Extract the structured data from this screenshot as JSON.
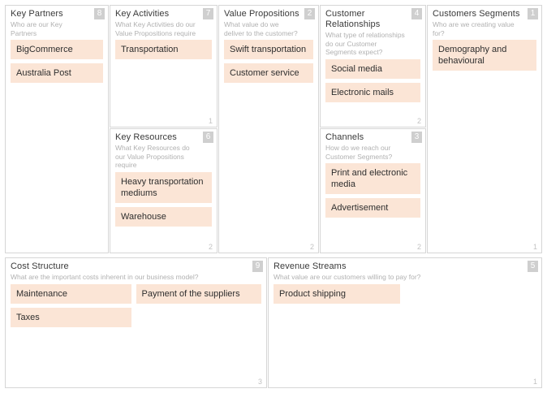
{
  "canvas": {
    "name": "Business Model Canvas",
    "note_color": "#fbe5d6",
    "badge_color": "#cfcfcf",
    "border_color": "#d6d6d6"
  },
  "blocks": {
    "key_partners": {
      "title": "Key Partners",
      "subtitle": "Who are our Key Partners",
      "badge": "8",
      "count": "",
      "notes": [
        "BigCommerce",
        "Australia Post"
      ]
    },
    "key_activities": {
      "title": "Key Activities",
      "subtitle": "What Key Activities do our Value Propositions require",
      "badge": "7",
      "count": "1",
      "notes": [
        "Transportation"
      ]
    },
    "key_resources": {
      "title": "Key Resources",
      "subtitle": "What Key Resources do our Value Propositions require",
      "badge": "6",
      "count": "2",
      "notes": [
        "Heavy transportation mediums",
        "Warehouse"
      ]
    },
    "value_propositions": {
      "title": "Value Propositions",
      "subtitle": "What value do we deliver to the customer?",
      "badge": "2",
      "count": "2",
      "notes": [
        "Swift transportation",
        "Customer service"
      ]
    },
    "customer_relationships": {
      "title": "Customer Relationships",
      "subtitle": "What type of relationships do our Customer Segments expect?",
      "badge": "4",
      "count": "2",
      "notes": [
        "Social media",
        "Electronic mails"
      ]
    },
    "channels": {
      "title": "Channels",
      "subtitle": "How do we reach our Customer Segments?",
      "badge": "3",
      "count": "2",
      "notes": [
        "Print and electronic media",
        "Advertisement"
      ]
    },
    "customer_segments": {
      "title": "Customers Segments",
      "subtitle": "Who are we creating value for?",
      "badge": "1",
      "count": "1",
      "notes": [
        "Demography and behavioural"
      ]
    },
    "cost_structure": {
      "title": "Cost Structure",
      "subtitle": "What are the important costs inherent in our business model?",
      "badge": "9",
      "count": "3",
      "notes_left": [
        "Maintenance",
        "Taxes"
      ],
      "notes_right": [
        "Payment of the suppliers"
      ]
    },
    "revenue_streams": {
      "title": "Revenue Streams",
      "subtitle": "What value are our customers willing to pay for?",
      "badge": "5",
      "count": "1",
      "notes_left": [
        "Product shipping"
      ],
      "notes_right": []
    }
  }
}
